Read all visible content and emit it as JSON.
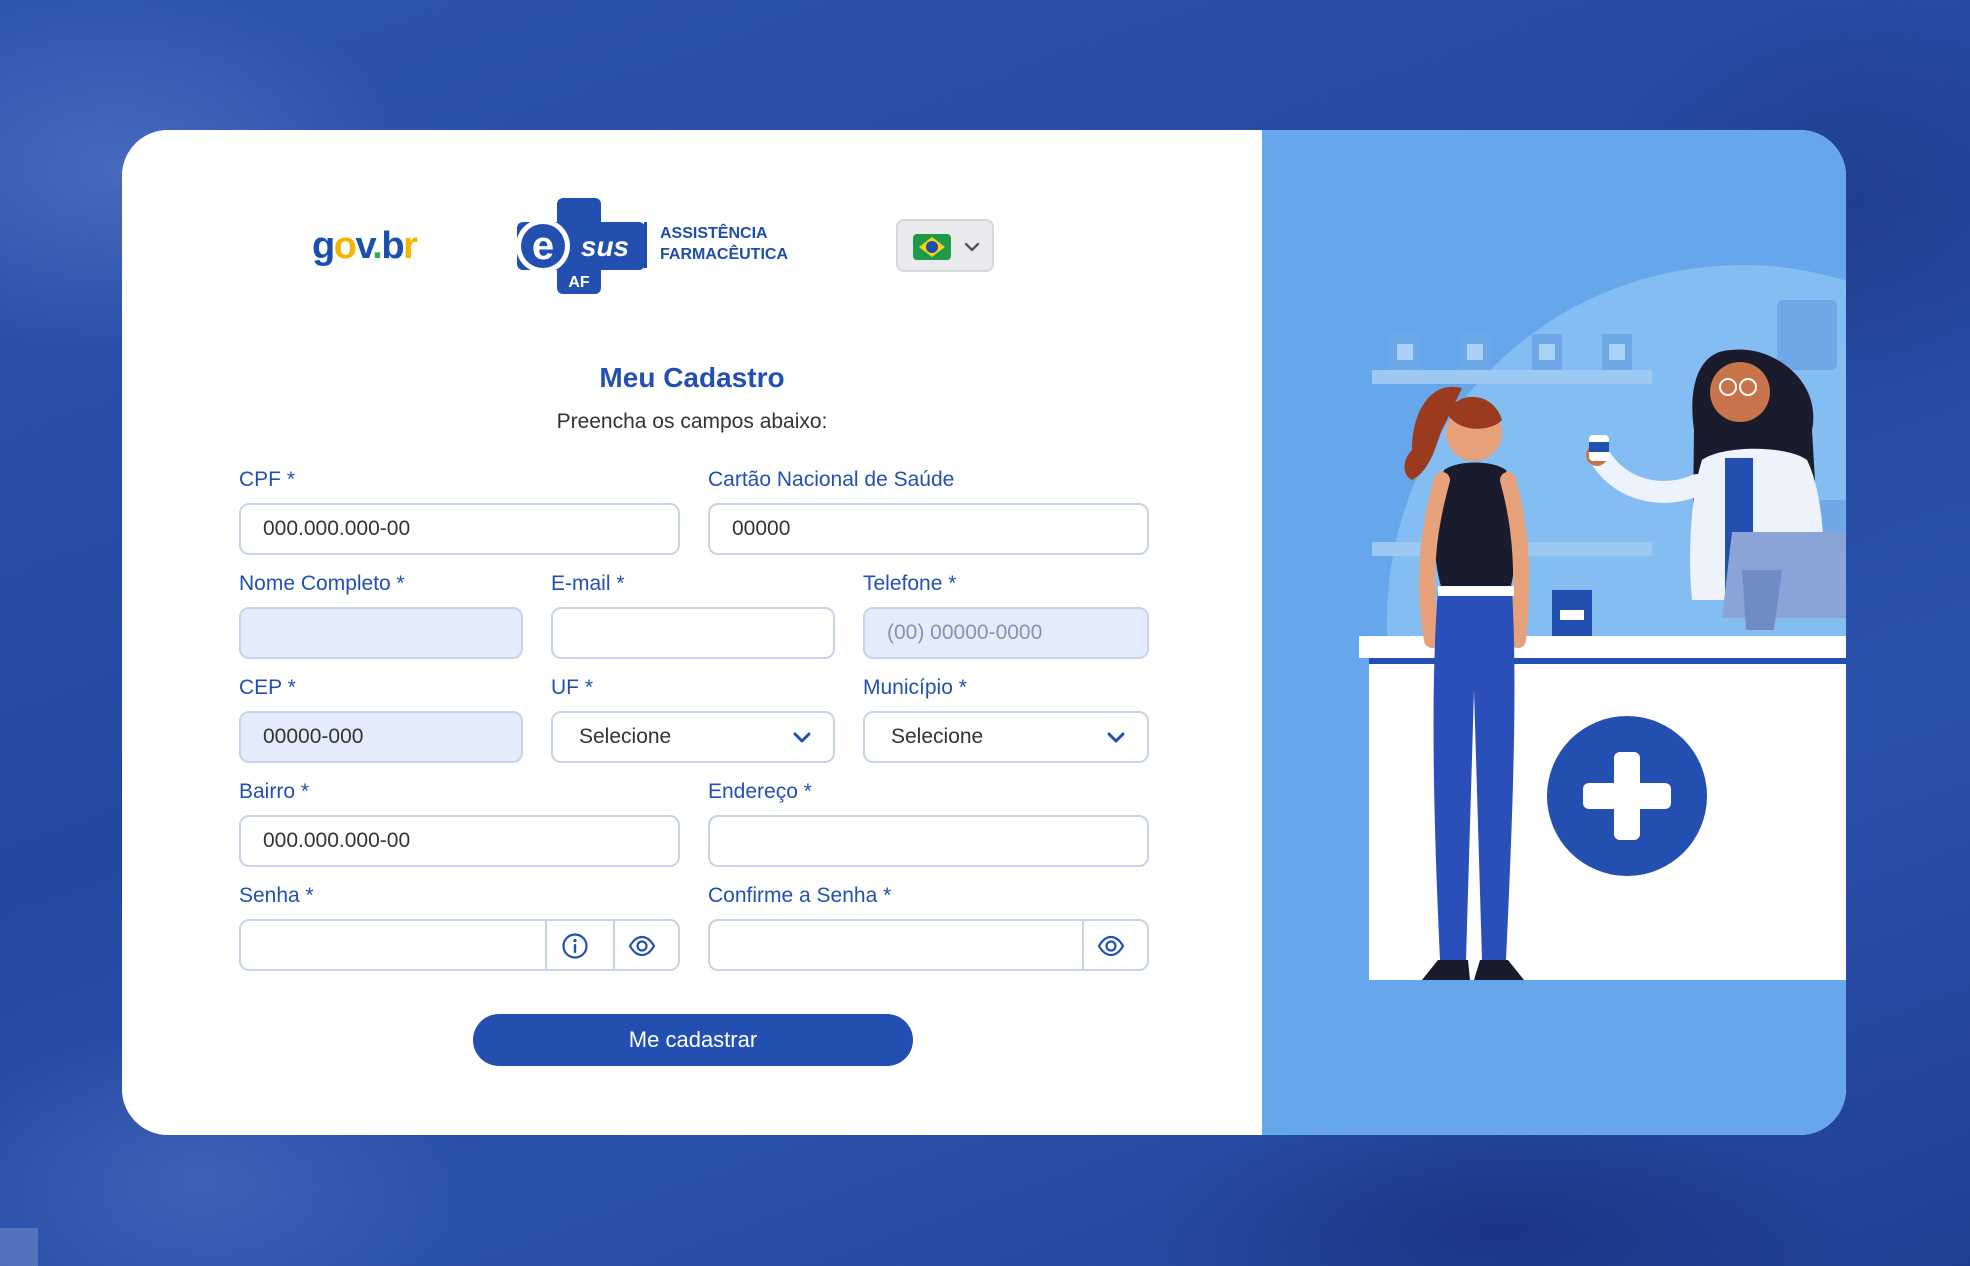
{
  "header": {
    "govbr_logo": {
      "g": "g",
      "o": "o",
      "v": "v",
      "dot": ".",
      "b": "b",
      "r": "r"
    },
    "esus_logo": {
      "e": "e",
      "sus": "sus",
      "af": "AF",
      "line1": "ASSISTÊNCIA",
      "line2": "FARMACÊUTICA"
    },
    "language": {
      "flag": "brazil-flag-icon",
      "icon": "chevron-down-icon"
    }
  },
  "form": {
    "title": "Meu Cadastro",
    "subtitle": "Preencha os campos abaixo:",
    "fields": {
      "cpf": {
        "label": "CPF *",
        "value": "000.000.000-00"
      },
      "cns": {
        "label": "Cartão Nacional de Saúde",
        "value": "00000"
      },
      "nome": {
        "label": "Nome Completo *",
        "value": ""
      },
      "email": {
        "label": "E-mail *",
        "value": ""
      },
      "telefone": {
        "label": "Telefone *",
        "placeholder": "(00) 00000-0000"
      },
      "cep": {
        "label": "CEP *",
        "value": "00000-000"
      },
      "uf": {
        "label": "UF *",
        "selected": "Selecione"
      },
      "municipio": {
        "label": "Município *",
        "selected": "Selecione"
      },
      "bairro": {
        "label": "Bairro *",
        "value": "000.000.000-00"
      },
      "endereco": {
        "label": "Endereço *",
        "value": ""
      },
      "senha": {
        "label": "Senha *",
        "value": ""
      },
      "confirme_senha": {
        "label": "Confirme a Senha *",
        "value": ""
      }
    },
    "submit_label": "Me cadastrar"
  },
  "colors": {
    "primary": "#2350b0",
    "background": "#2a4fa8",
    "illustration_bg": "#66a6ea",
    "filled_field": "#e3ecfb"
  }
}
